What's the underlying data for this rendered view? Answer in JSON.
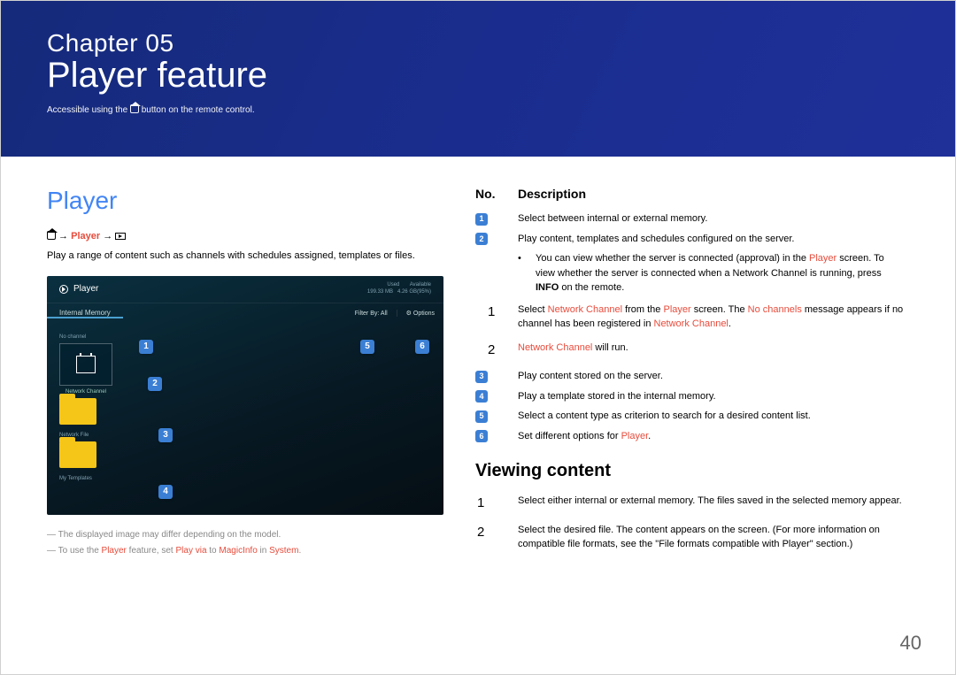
{
  "hero": {
    "chapter": "Chapter 05",
    "title": "Player feature",
    "accessible_pre": "Accessible using the ",
    "accessible_post": " button on the remote control."
  },
  "left": {
    "heading": "Player",
    "path_player": "Player",
    "intro": "Play a range of content such as channels with schedules assigned, templates or files.",
    "screenshot": {
      "title": "Player",
      "used_lbl": "Used",
      "used_val": "199.33 MB",
      "avail_lbl": "Available",
      "avail_val": "4.26 GB(95%)",
      "tab1": "Internal Memory",
      "filter": "Filter By: All",
      "options": "Options",
      "sec_nochannel": "No channel",
      "tile_network_channel": "Network Channel",
      "sec_networkfile": "Network File",
      "sec_mytemplates": "My Templates"
    },
    "note1": "The displayed image may differ depending on the model.",
    "note2_a": "To use the ",
    "note2_b": " feature, set ",
    "note2_c": " to ",
    "note2_d": " in ",
    "note2_player": "Player",
    "note2_playvia": "Play via",
    "note2_magicinfo": "MagicInfo",
    "note2_system": "System"
  },
  "right": {
    "col_no": "No.",
    "col_desc": "Description",
    "row1": "Select between internal or external memory.",
    "row2": "Play content, templates and schedules configured on the server.",
    "row2_b1_a": "You can view whether the server is connected (approval) in the ",
    "row2_b1_b": " screen. To view whether the server is connected when a Network Channel is running, press ",
    "row2_b1_c": " on the remote.",
    "info": "INFO",
    "player_red": "Player",
    "nc_red": "Network Channel",
    "nochan_red": "No channels",
    "step1_a": "Select ",
    "step1_b": " from the ",
    "step1_c": " screen. The ",
    "step1_d": " message appears if no channel has been registered in ",
    "step1_e": ".",
    "step2_a": " will run.",
    "row3": "Play content stored on the server.",
    "row4": "Play a template stored in the internal memory.",
    "row5": "Select a content type as criterion to search for a desired content list.",
    "row6_a": "Set different options for ",
    "row6_b": ".",
    "viewing_h": "Viewing content",
    "v1": "Select either internal or external memory. The files saved in the selected memory appear.",
    "v2": "Select the desired file. The content appears on the screen. (For more information on compatible file formats, see the \"File formats compatible with Player\" section.)"
  },
  "page_no": "40"
}
